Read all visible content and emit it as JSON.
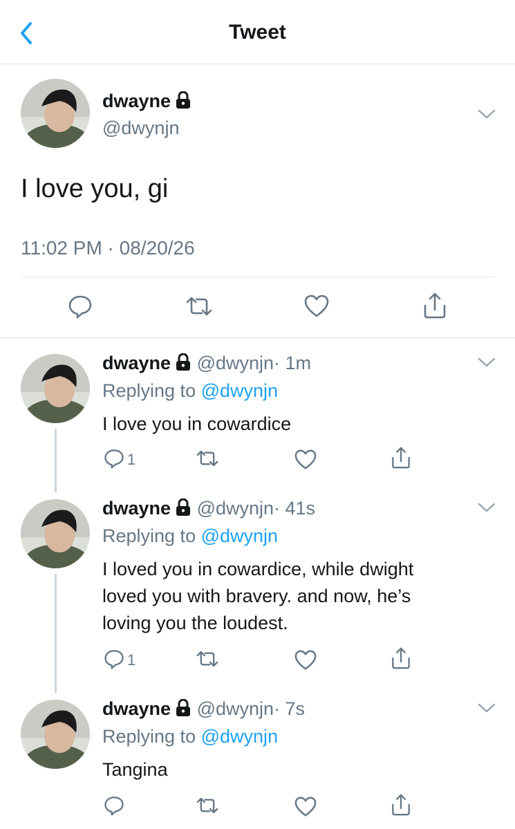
{
  "header": {
    "title": "Tweet"
  },
  "main_tweet": {
    "name": "dwayne",
    "handle": "@dwynjn",
    "text": "I love you, gi",
    "timestamp": "11:02 PM · 08/20/26"
  },
  "replies": [
    {
      "name": "dwayne",
      "handle": "@dwynjn",
      "time": "· 1m",
      "replying_prefix": "Replying to",
      "replying_handle": "@dwynjn",
      "text": "I love you in cowardice",
      "reply_count": "1"
    },
    {
      "name": "dwayne",
      "handle": "@dwynjn",
      "time": "· 41s",
      "replying_prefix": "Replying to",
      "replying_handle": "@dwynjn",
      "text_lines": [
        "I loved you in cowardice, while dwight",
        "loved you with bravery. and now, he’s",
        "loving you the loudest."
      ],
      "reply_count": "1"
    },
    {
      "name": "dwayne",
      "handle": "@dwynjn",
      "time": "· 7s",
      "replying_prefix": "Replying to",
      "replying_handle": "@dwynjn",
      "text": "Tangina",
      "reply_count": ""
    }
  ],
  "colors": {
    "accent": "#1da1f2",
    "secondary_text": "#657786",
    "primary_text": "#14171a",
    "divider": "#e1e8ed",
    "thread_line": "#ccd6dd"
  },
  "icons": [
    "back-chevron-icon",
    "lock-icon",
    "chevron-down-icon",
    "reply-icon",
    "retweet-icon",
    "like-icon",
    "share-icon"
  ]
}
